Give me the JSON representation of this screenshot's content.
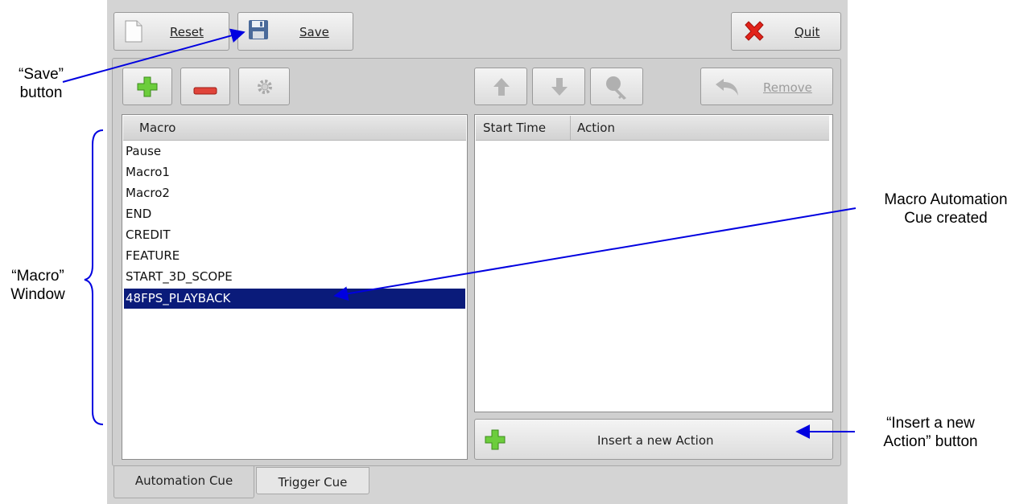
{
  "toolbar": {
    "reset_label": "Reset",
    "save_label": "Save",
    "quit_label": "Quit"
  },
  "macro_toolbar": {
    "remove_label": "Remove"
  },
  "macro_list": {
    "header": "Macro",
    "items": [
      "Pause",
      "Macro1",
      "Macro2",
      "END",
      "CREDIT",
      "FEATURE",
      "START_3D_SCOPE",
      "48FPS_PLAYBACK"
    ],
    "selected": "48FPS_PLAYBACK"
  },
  "action_table": {
    "columns": [
      "Start Time",
      "Action"
    ],
    "rows": []
  },
  "insert_action_label": "Insert a new Action",
  "tabs": [
    "Automation Cue",
    "Trigger Cue"
  ],
  "annotations": {
    "save_button": [
      "“Save”",
      "button"
    ],
    "macro_window": [
      "“Macro”",
      "Window"
    ],
    "cue_created": [
      "Macro Automation",
      "Cue created"
    ],
    "insert_button": [
      "“Insert a new",
      "Action” button"
    ]
  },
  "colors": {
    "selection": "#0a1b7a",
    "annotation_arrow": "#0000e0",
    "add_icon": "#6ccd3c",
    "remove_icon": "#e0443a",
    "quit_icon": "#e2231a"
  },
  "icons": [
    "document-icon",
    "floppy-disk-icon",
    "close-x-icon",
    "plus-icon",
    "minus-icon",
    "gear-icon",
    "arrow-up-icon",
    "arrow-down-icon",
    "key-icon",
    "undo-arrow-icon"
  ]
}
